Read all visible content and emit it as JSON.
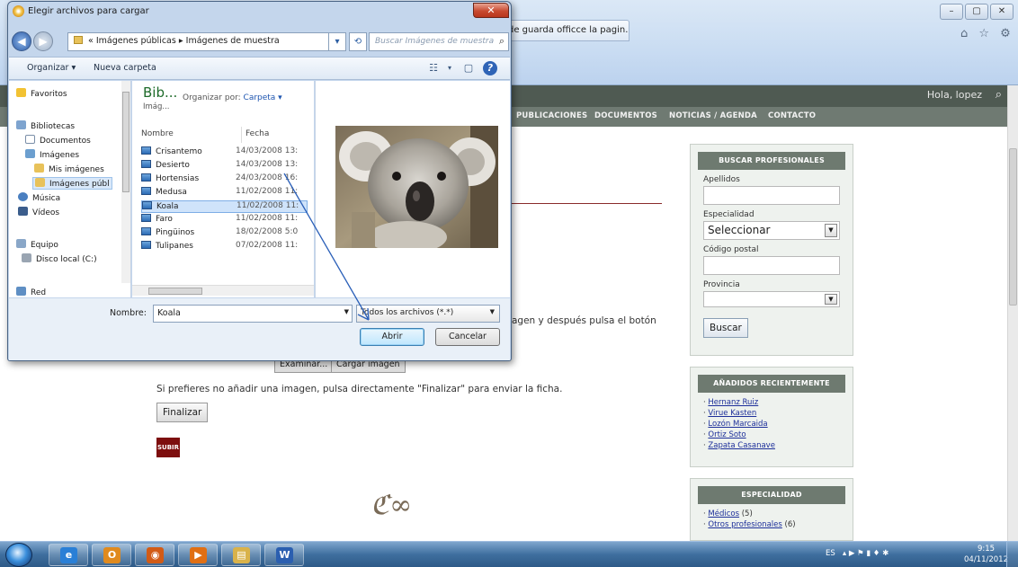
{
  "browser": {
    "tab_title": "de guarda officce la pagin...",
    "win_controls": [
      "–",
      "▢",
      "✕"
    ],
    "toolbar_icons": "⌂ ☆ ⚙"
  },
  "site": {
    "greeting": "Hola, lopez",
    "nav": [
      "PUBLICACIONES",
      "DOCUMENTOS",
      "NOTICIAS / AGENDA",
      "CONTACTO"
    ],
    "instructions_tail": "agen y después pulsa el botón",
    "btn_examinar": "Examinar...",
    "btn_cargar": "Cargar imagen",
    "skip_text": "Si prefieres no añadir una imagen, pulsa directamente \"Finalizar\" para enviar la ficha.",
    "btn_finalizar": "Finalizar",
    "btn_subir": "SUBIR",
    "flourish": "ℭ∞"
  },
  "search_panel": {
    "title": "BUSCAR PROFESIONALES",
    "apellidos_label": "Apellidos",
    "apellidos_value": "",
    "especialidad_label": "Especialidad",
    "especialidad_value": "Seleccionar",
    "cp_label": "Código postal",
    "cp_value": "",
    "provincia_label": "Provincia",
    "provincia_value": "",
    "buscar_button": "Buscar"
  },
  "recent_panel": {
    "title": "AÑADIDOS RECIENTEMENTE",
    "items": [
      "Hernanz Ruiz",
      "Virue Kasten",
      "Lozón Marcaida",
      "Ortiz Soto",
      "Zapata Casanave"
    ]
  },
  "specialty_panel": {
    "title": "ESPECIALIDAD",
    "items": [
      {
        "label": "Médicos",
        "count": "(5)"
      },
      {
        "label": "Otros profesionales",
        "count": "(6)"
      }
    ]
  },
  "dialog": {
    "title": "Elegir archivos para cargar",
    "close_label": "✕",
    "address": {
      "prefix": "«",
      "part1": "Imágenes públicas",
      "sep": "▸",
      "part2": "Imágenes de muestra"
    },
    "search_placeholder": "Buscar Imágenes de muestra",
    "toolbar": {
      "organizar": "Organizar ▾",
      "nueva_carpeta": "Nueva carpeta"
    },
    "nav": {
      "favoritos": "Favoritos",
      "bibliotecas": "Bibliotecas",
      "documentos": "Documentos",
      "imagenes": "Imágenes",
      "mis_imagenes": "Mis imágenes",
      "imagenes_publ": "Imágenes públ",
      "musica": "Música",
      "videos": "Vídeos",
      "equipo": "Equipo",
      "disco": "Disco local (C:)",
      "red": "Red"
    },
    "library": {
      "title": "Bib...",
      "subtitle": "Imág...",
      "organize_by_label": "Organizar por:",
      "organize_by_value": "Carpeta ▾"
    },
    "columns": {
      "nombre": "Nombre",
      "fecha": "Fecha"
    },
    "files": [
      {
        "name": "Crisantemo",
        "date": "14/03/2008 13:"
      },
      {
        "name": "Desierto",
        "date": "14/03/2008 13:"
      },
      {
        "name": "Hortensias",
        "date": "24/03/2008 16:"
      },
      {
        "name": "Medusa",
        "date": "11/02/2008 11:"
      },
      {
        "name": "Koala",
        "date": "11/02/2008 11:"
      },
      {
        "name": "Faro",
        "date": "11/02/2008 11:"
      },
      {
        "name": "Pingüinos",
        "date": "18/02/2008 5:0"
      },
      {
        "name": "Tulipanes",
        "date": "07/02/2008 11:"
      }
    ],
    "selected_file": "Koala",
    "filename_label": "Nombre:",
    "filename_value": "Koala",
    "filetype_value": "Todos los archivos (*.*)",
    "open_button": "Abrir",
    "cancel_button": "Cancelar"
  },
  "taskbar": {
    "tray_lang": "ES",
    "tray_icons": "▴ ▶ ⚑ ▮ ♦ ✱",
    "time": "9:15",
    "date": "04/11/2012",
    "apps": [
      {
        "name": "ie",
        "glyph": "e",
        "color": "#2a7fd6"
      },
      {
        "name": "outlook",
        "glyph": "O",
        "color": "#e08a1e"
      },
      {
        "name": "firefox",
        "glyph": "◉",
        "color": "#d25b16"
      },
      {
        "name": "media-player",
        "glyph": "▶",
        "color": "#e06f14"
      },
      {
        "name": "explorer",
        "glyph": "▤",
        "color": "#d9b24a"
      },
      {
        "name": "word",
        "glyph": "W",
        "color": "#2b5fb0"
      }
    ]
  }
}
